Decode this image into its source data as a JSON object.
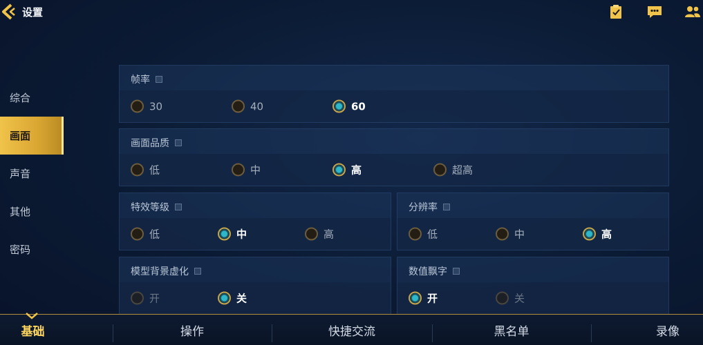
{
  "header": {
    "title": "设置",
    "back_icon": "chevron-left-icon",
    "icons": [
      "clipboard-check-icon",
      "chat-bubble-icon",
      "friends-icon"
    ],
    "accent_color": "#f0c34a"
  },
  "sidebar": {
    "items": [
      {
        "label": "综合",
        "active": false
      },
      {
        "label": "画面",
        "active": true
      },
      {
        "label": "声音",
        "active": false
      },
      {
        "label": "其他",
        "active": false
      },
      {
        "label": "密码",
        "active": false
      }
    ]
  },
  "settings": {
    "framerate": {
      "title": "帧率",
      "options": [
        "30",
        "40",
        "60"
      ],
      "selected": "60"
    },
    "quality": {
      "title": "画面品质",
      "options": [
        "低",
        "中",
        "高",
        "超高"
      ],
      "selected": "高"
    },
    "effects": {
      "title": "特效等级",
      "options": [
        "低",
        "中",
        "高"
      ],
      "selected": "中"
    },
    "resolution": {
      "title": "分辨率",
      "options": [
        "低",
        "中",
        "高"
      ],
      "selected": "高"
    },
    "model_blur": {
      "title": "模型背景虚化",
      "options": [
        "开",
        "关"
      ],
      "selected": "关"
    },
    "damage_numbers": {
      "title": "数值飘字",
      "options": [
        "开",
        "关"
      ],
      "selected": "开"
    }
  },
  "bottom_tabs": [
    {
      "label": "基础",
      "active": true
    },
    {
      "label": "操作",
      "active": false
    },
    {
      "label": "快捷交流",
      "active": false
    },
    {
      "label": "黑名单",
      "active": false
    },
    {
      "label": "录像",
      "active": false
    }
  ]
}
